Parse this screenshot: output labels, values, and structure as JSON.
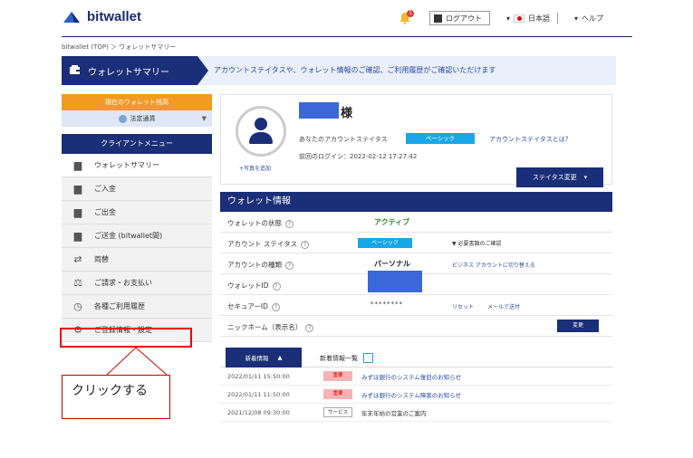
{
  "header": {
    "brand": "bitwallet",
    "notification_count": "1",
    "logout_label": "ログアウト",
    "language": "日本語",
    "help": "ヘルプ"
  },
  "breadcrumb": "bitwallet (TOP) ＞ ウォレットサマリー",
  "titlebar": {
    "title": "ウォレットサマリー",
    "description": "アカウントステイタスや、ウォレット情報のご確認、ご利用履歴がご確認いただけます"
  },
  "sidebar": {
    "current_wallet": "現在のウォレット残高",
    "currency": "法定通貨",
    "menu_title": "クライアントメニュー",
    "items": [
      {
        "label": "ウォレットサマリー"
      },
      {
        "label": "ご入金"
      },
      {
        "label": "ご出金"
      },
      {
        "label": "ご送金 (bitwallet間)"
      },
      {
        "label": "両替"
      },
      {
        "label": "ご請求・お支払い"
      },
      {
        "label": "各種ご利用履歴"
      },
      {
        "label": "ご登録情報・設定"
      }
    ]
  },
  "callout": {
    "text": "クリックする"
  },
  "profile": {
    "honorific": "様",
    "account_status_label": "あなたのアカウントステイタス",
    "account_status_value": "ベーシック",
    "account_status_link": "アカウントステイタスとは？",
    "last_login": "前回のログイン：2022-02-12 17:27:42",
    "add_photo": "+写真を追加",
    "status_upgrade": "ステイタス変更"
  },
  "wallet_info": {
    "title": "ウォレット情報",
    "rows": [
      {
        "label": "ウォレットの状態",
        "value": "アクティブ"
      },
      {
        "label": "アカウント ステイタス",
        "value": "ベーシック",
        "link": "▼ 必要書類のご確認"
      },
      {
        "label": "アカウントの種類",
        "value": "パーソナル",
        "link": "ビジネス アカウントに切り替える"
      },
      {
        "label": "ウォレットID"
      },
      {
        "label": "セキュアーID",
        "value": "********",
        "link1": "リセット",
        "link2": "メールで送付"
      },
      {
        "label": "ニックネーム（表示名）",
        "button": "変更"
      }
    ]
  },
  "news": {
    "tab_active": "新着情報",
    "tab_list": "新着情報一覧",
    "items": [
      {
        "date": "2022/01/11 15:50:00",
        "tag": "重要",
        "title": "みずほ銀行のシステム復旧のお知らせ"
      },
      {
        "date": "2022/01/11 11:50:00",
        "tag": "重要",
        "title": "みずほ銀行のシステム障害のお知らせ"
      },
      {
        "date": "2021/12/08 09:30:00",
        "tag": "サービス",
        "title": "年末年始の営業のご案内"
      }
    ]
  }
}
